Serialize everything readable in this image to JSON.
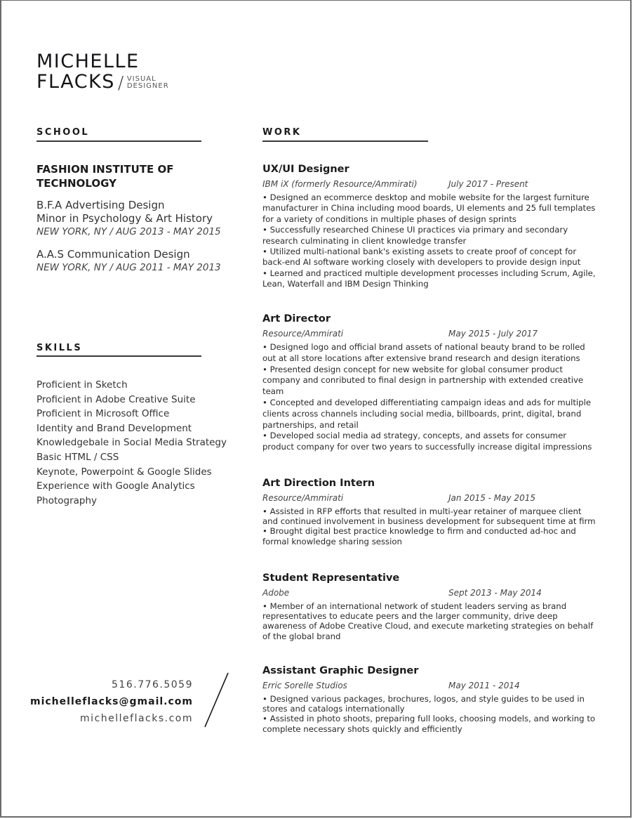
{
  "header": {
    "first_name": "MICHELLE",
    "last_name": "FLACKS",
    "slash": "/",
    "role_line1": "VISUAL",
    "role_line2": "DESIGNER"
  },
  "school": {
    "heading": "SCHOOL",
    "institution_line1": "FASHION INSTITUTE OF",
    "institution_line2": "TECHNOLOGY",
    "degrees": [
      {
        "line1": "B.F.A Advertising Design",
        "line2": "Minor in Psychology & Art History",
        "location_dates": "NEW YORK, NY / AUG 2013 - MAY 2015"
      },
      {
        "line1": "A.A.S Communication Design",
        "location_dates": "NEW YORK, NY / AUG 2011 - MAY 2013"
      }
    ]
  },
  "skills": {
    "heading": "SKILLS",
    "items": [
      "Proficient in Sketch",
      "Proficient in Adobe Creative Suite",
      "Proficient in Microsoft Office",
      "Identity and Brand Development",
      "Knowledgebale in Social Media Strategy",
      "Basic HTML / CSS",
      "Keynote, Powerpoint & Google Slides",
      "Experience with Google Analytics",
      "Photography"
    ]
  },
  "contact": {
    "phone": "516.776.5059",
    "email": "michelleflacks@gmail.com",
    "website": "michelleflacks.com"
  },
  "work": {
    "heading": "WORK",
    "jobs": [
      {
        "title": "UX/UI Designer",
        "company": "IBM iX (formerly Resource/Ammirati)",
        "dates": "July 2017 - Present",
        "bullets": [
          "• Designed an ecommerce desktop and mobile website for the largest furniture manufacturer in China including mood boards, UI elements and 25 full templates for a variety of conditions in multiple phases of design sprints",
          "• Successfully researched Chinese UI practices via primary and secondary research culminating in client knowledge transfer",
          "• Utilized multi-national bank's existing assets to create proof of concept for back-end AI software working closely with developers to provide design input",
          "• Learned and practiced multiple development processes including Scrum, Agile, Lean, Waterfall and IBM Design Thinking"
        ]
      },
      {
        "title": "Art Director",
        "company": "Resource/Ammirati",
        "dates": "May 2015 - July 2017",
        "bullets": [
          "• Designed logo and official brand assets of national beauty brand to be rolled out at all store locations after extensive brand research and design iterations",
          " • Presented design concept for new website for global consumer product company and conributed to final design in partnership with extended creative team",
          " • Concepted and developed differentiating campaign ideas and ads for multiple clients across channels including social media, billboards, print, digital, brand partnerships, and retail",
          " • Developed social media ad strategy, concepts, and assets for consumer product company for over two years to successfully increase digital impressions"
        ]
      },
      {
        "title": "Art Direction Intern",
        "company": "Resource/Ammirati",
        "dates": "Jan 2015 - May 2015",
        "bullets": [
          "• Assisted in RFP efforts that resulted in multi-year retainer of marquee client and continued involvement in business development for subsequent time at firm",
          "• Brought digital best practice knowledge to firm and conducted ad-hoc and formal knowledge sharing session"
        ]
      },
      {
        "title": "Student Representative",
        "company": "Adobe",
        "dates": "Sept 2013 - May 2014",
        "bullets": [
          "• Member of an international network of student leaders serving as brand representatives to educate peers and the larger community, drive deep awareness of Adobe Creative Cloud, and execute marketing strategies on behalf of the global brand"
        ]
      },
      {
        "title": "Assistant Graphic Designer",
        "company": "Erric Sorelle Studios",
        "dates": "May 2011 - 2014",
        "bullets": [
          "• Designed various packages, brochures, logos, and style guides to be used in stores and catalogs internationally",
          "• Assisted in photo shoots, preparing full looks, choosing models, and working to complete necessary shots quickly and efficiently"
        ]
      }
    ]
  }
}
